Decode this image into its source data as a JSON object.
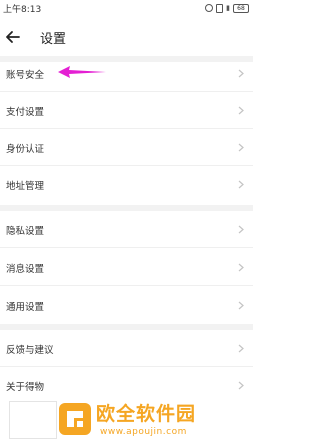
{
  "status_bar": {
    "time": "上午8:13",
    "battery": "68"
  },
  "header": {
    "title": "设置"
  },
  "settings_groups": [
    {
      "items": [
        {
          "label": "账号安全"
        },
        {
          "label": "支付设置"
        },
        {
          "label": "身份认证"
        },
        {
          "label": "地址管理"
        }
      ]
    },
    {
      "items": [
        {
          "label": "隐私设置"
        },
        {
          "label": "消息设置"
        },
        {
          "label": "通用设置"
        }
      ]
    },
    {
      "items": [
        {
          "label": "反馈与建议"
        },
        {
          "label": "关于得物"
        }
      ]
    }
  ],
  "annotation": {
    "arrow_color": "#e41fd3"
  },
  "watermark": {
    "site_name": "欧全软件园",
    "url": "www.apoujin.com",
    "color": "#f5a623"
  }
}
